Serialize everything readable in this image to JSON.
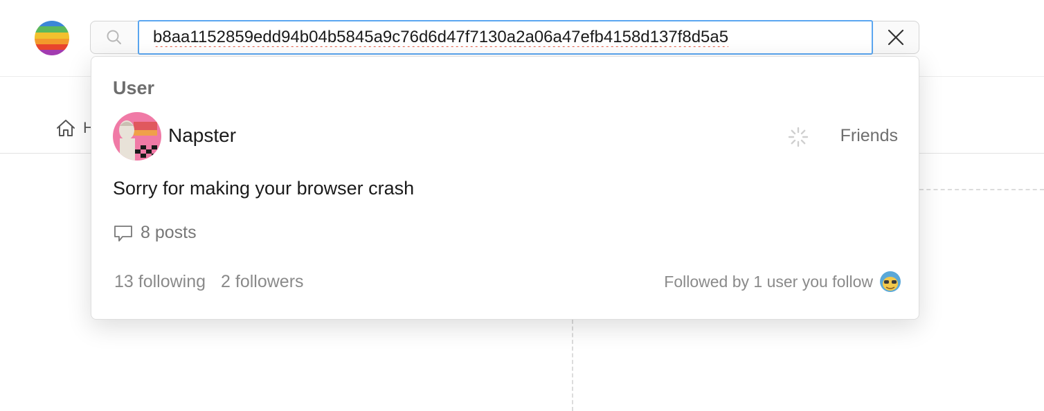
{
  "header": {
    "logo": "rainbow-ball-logo",
    "search": {
      "icon": "search-icon",
      "value": "b8aa1152859edd94b04b5845a9c76d6d47f7130a2a06a47efb4158d137f8d5a5",
      "clear_icon": "close-icon"
    }
  },
  "nav": {
    "home_icon": "home-icon",
    "home_label": "H"
  },
  "dropdown": {
    "section_title": "User",
    "user": {
      "name": "Napster",
      "status_label": "Friends",
      "bio": "Sorry for making your browser crash",
      "posts_label": "8 posts",
      "following_label": "13 following",
      "followers_label": "2 followers",
      "followed_by_label": "Followed by 1 user you follow"
    }
  },
  "colors": {
    "input_focus_border": "#5aa6f0",
    "spellcheck_underline": "#e5533c",
    "muted_text": "#8a8a8a"
  }
}
